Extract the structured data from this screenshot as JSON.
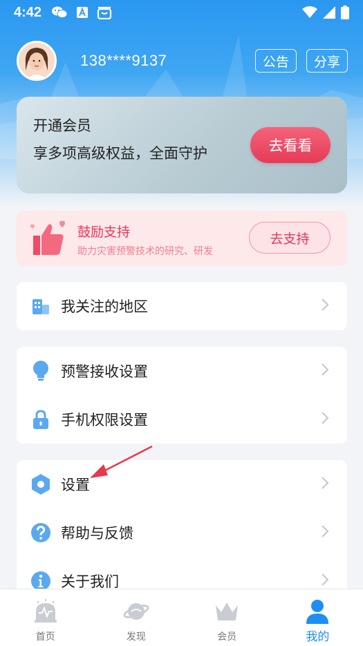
{
  "status_bar": {
    "time": "4:42",
    "icons_left": [
      "wechat-icon",
      "font-a-icon",
      "store-icon"
    ],
    "icons_right": [
      "wifi-icon",
      "signal-icon",
      "battery-icon"
    ]
  },
  "profile": {
    "avatar": "avatar",
    "phone": "138****9137",
    "announce_label": "公告",
    "share_label": "分享"
  },
  "vip_card": {
    "title": "开通会员",
    "subtitle": "享多项高级权益，全面守护",
    "button_label": "去看看"
  },
  "support_card": {
    "title": "鼓励支持",
    "subtitle": "助力灾害预警技术的研究、研发",
    "button_label": "去支持"
  },
  "menu": {
    "followed_regions": "我关注的地区",
    "alert_settings": "预警接收设置",
    "permission_settings": "手机权限设置",
    "settings": "设置",
    "help_feedback": "帮助与反馈",
    "about_us": "关于我们"
  },
  "bottom_nav": {
    "home": "首页",
    "discover": "发现",
    "member": "会员",
    "mine": "我的"
  },
  "colors": {
    "accent": "#1f8ef1",
    "vip_button": "#e53b57",
    "support_text": "#e8365a",
    "icon_blue": "#5aa9f0"
  }
}
